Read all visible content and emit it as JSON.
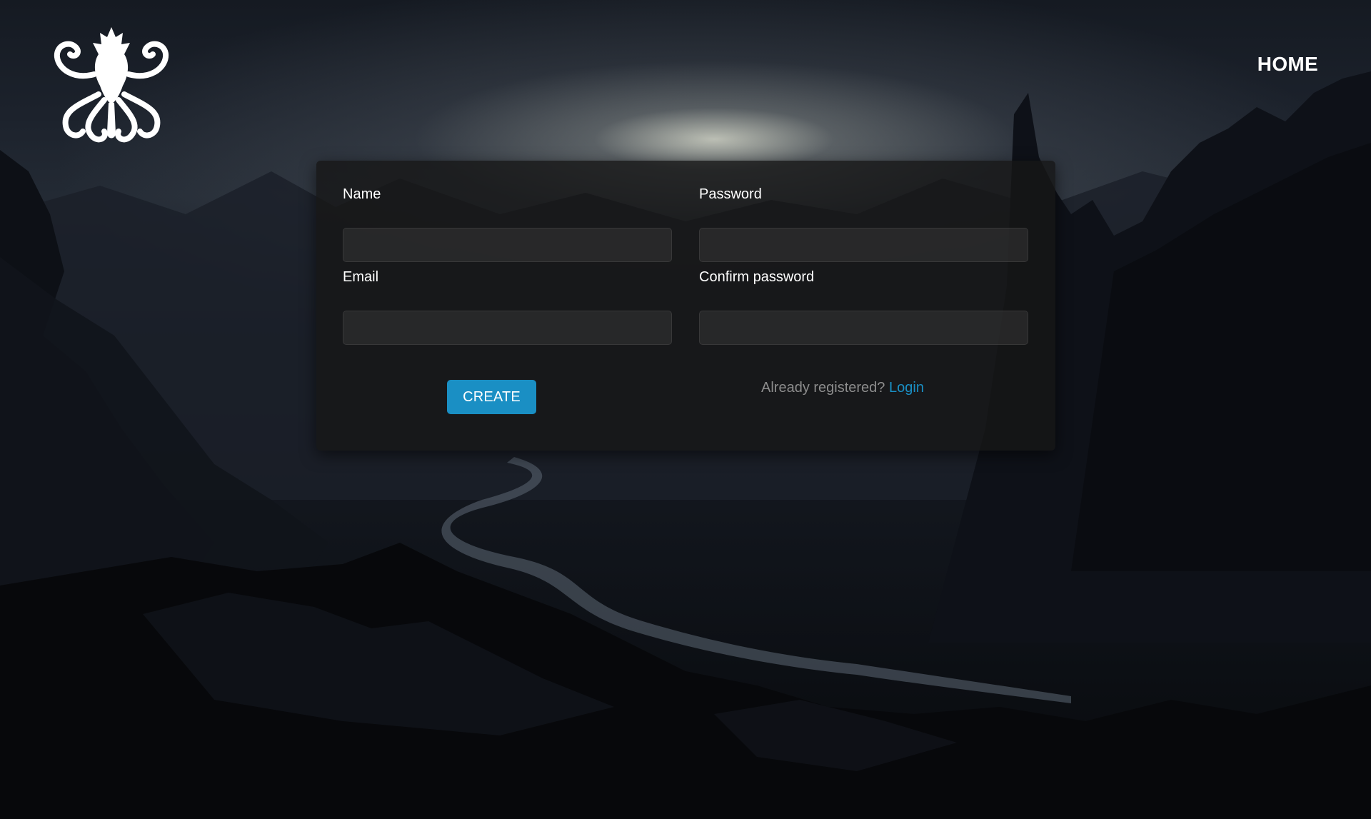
{
  "header": {
    "logo_icon": "kraken-logo-icon",
    "nav_home_label": "HOME"
  },
  "form": {
    "name_label": "Name",
    "name_value": "",
    "email_label": "Email",
    "email_value": "",
    "password_label": "Password",
    "password_value": "",
    "confirm_password_label": "Confirm password",
    "confirm_password_value": "",
    "create_button_label": "CREATE",
    "already_registered_text": "Already registered?",
    "login_link_label": "Login"
  },
  "colors": {
    "accent": "#1a8fc4",
    "card_background": "rgba(22,22,22,0.80)",
    "muted_text": "#8d8d8d"
  }
}
